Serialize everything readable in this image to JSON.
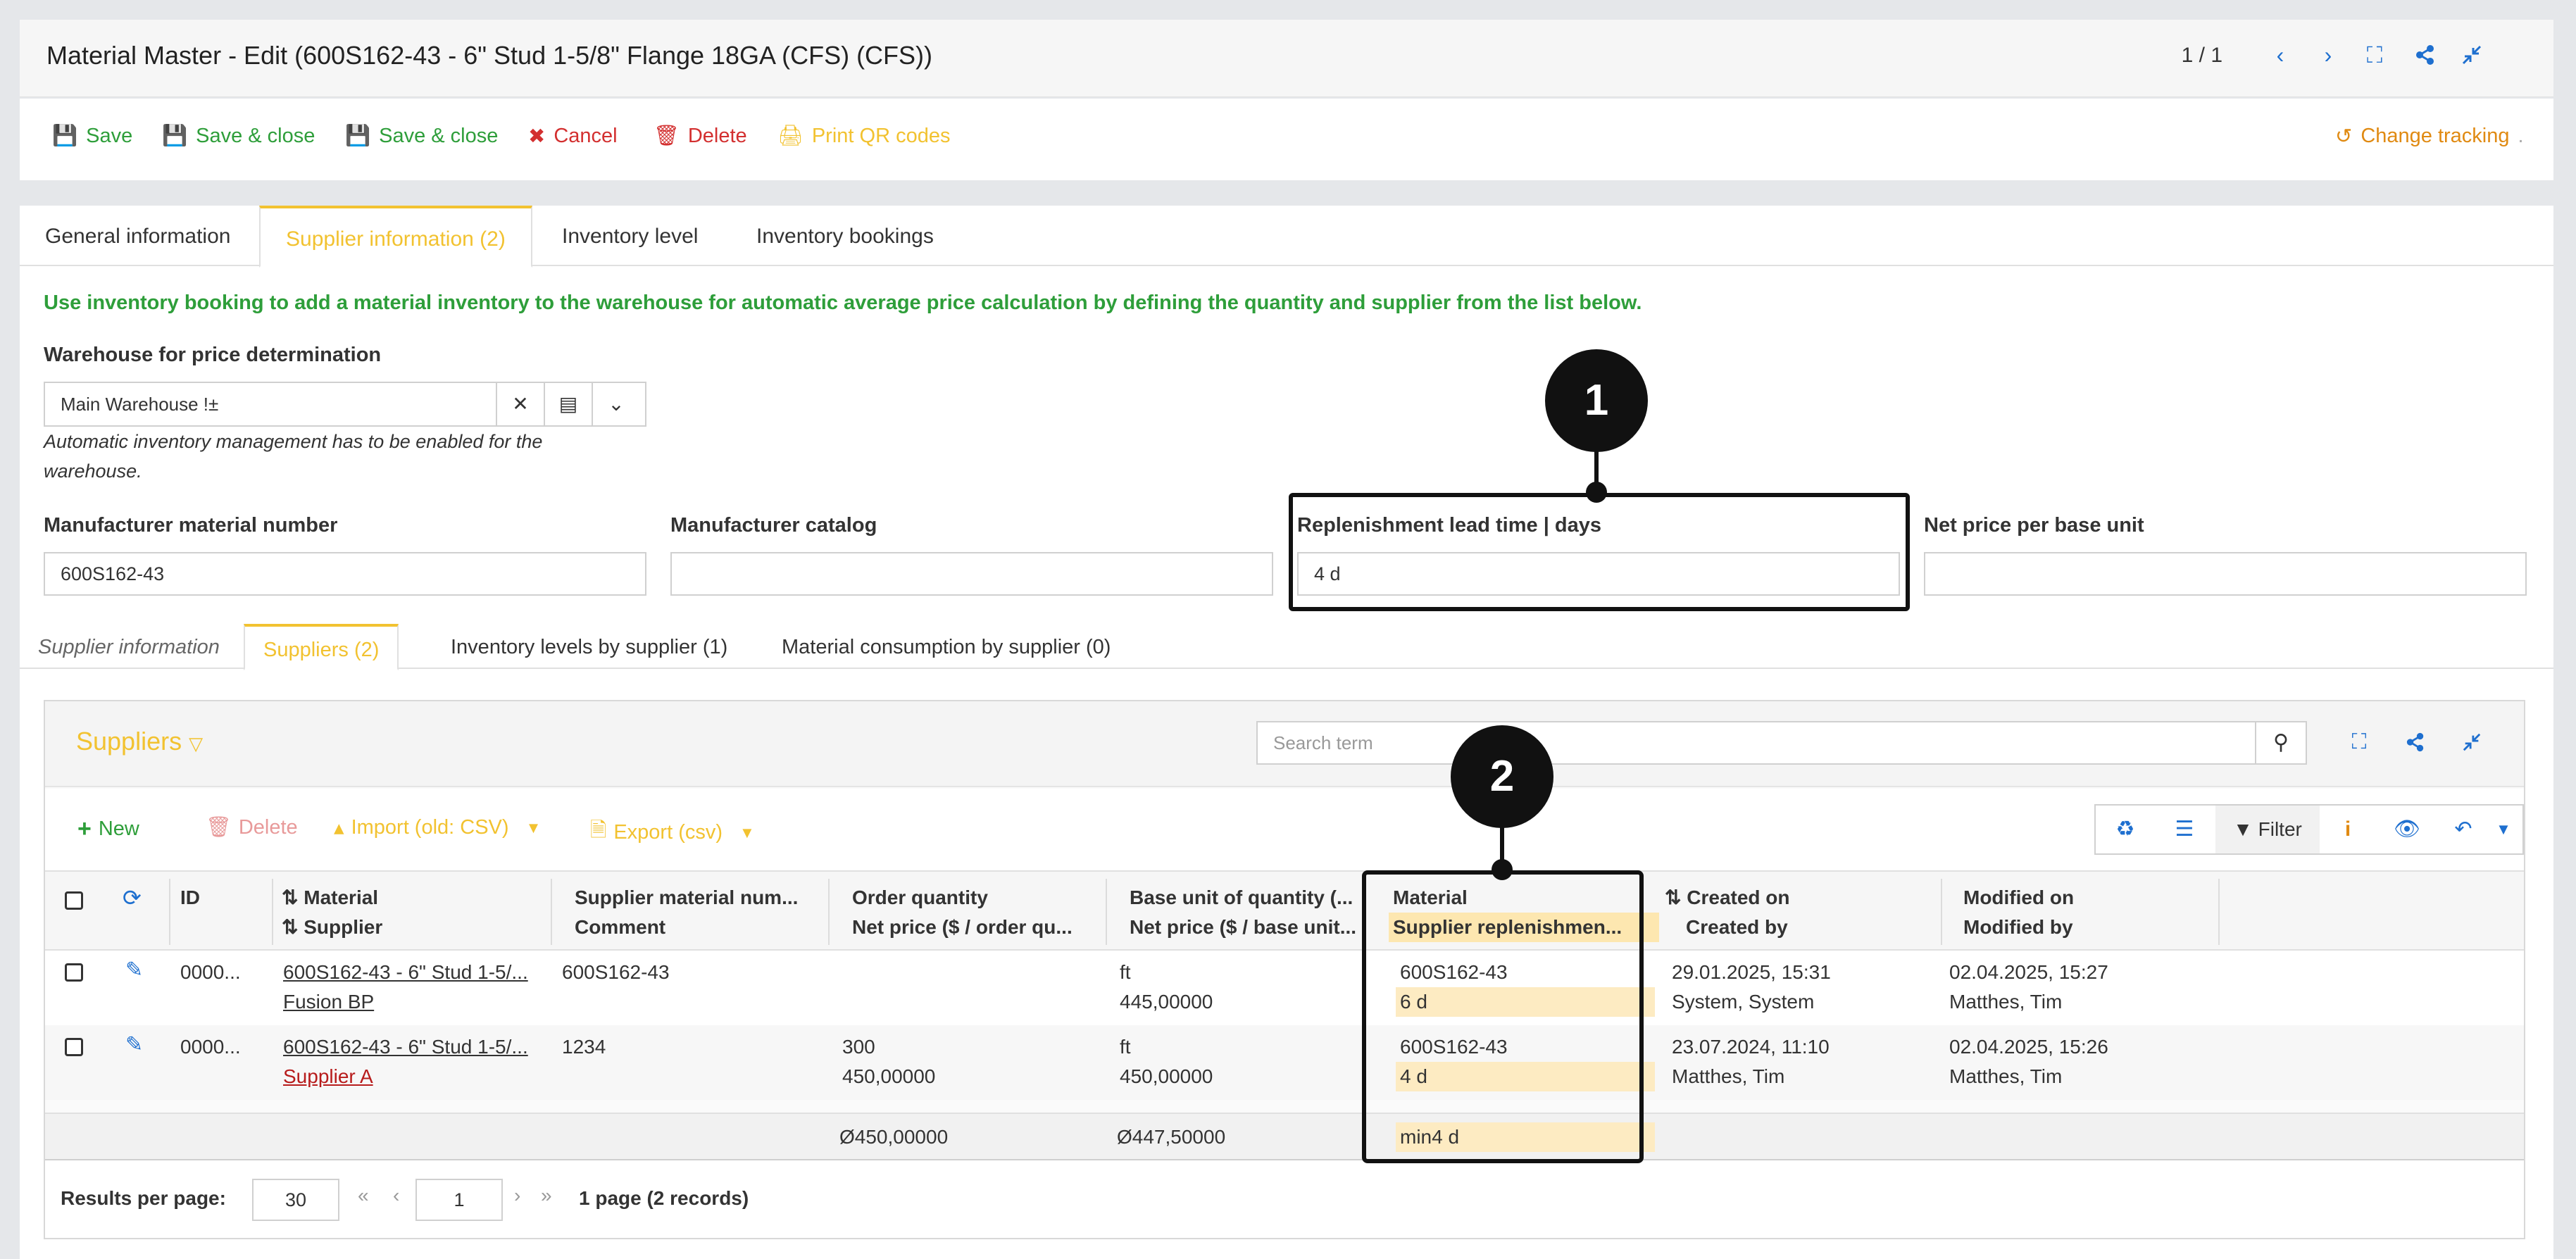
{
  "window": {
    "title": "Material Master - Edit (600S162-43 - 6\" Stud 1-5/8\" Flange 18GA (CFS) (CFS))",
    "pager": "1 / 1"
  },
  "toolbar": {
    "save": "Save",
    "save_close_1": "Save & close",
    "save_close_2": "Save & close",
    "cancel": "Cancel",
    "delete": "Delete",
    "print_qr": "Print QR codes",
    "change_tracking": "Change tracking"
  },
  "tabs": [
    "General information",
    "Supplier information (2)",
    "Inventory level",
    "Inventory bookings"
  ],
  "info_text": "Use inventory booking to add a material inventory to the warehouse for automatic average price calculation by defining the quantity and supplier from the list below.",
  "warehouse": {
    "label": "Warehouse for price determination",
    "value": "Main Warehouse !±",
    "hint_line1": "Automatic inventory management has to be enabled for the",
    "hint_line2": "warehouse."
  },
  "fields": {
    "mfr_number_label": "Manufacturer material number",
    "mfr_number_value": "600S162-43",
    "mfr_catalog_label": "Manufacturer catalog",
    "mfr_catalog_value": "",
    "lead_time_label": "Replenishment lead time | days",
    "lead_time_value": "4 d",
    "net_price_label": "Net price per base unit",
    "net_price_value": ""
  },
  "callouts": {
    "one": "1",
    "two": "2"
  },
  "subtabs": [
    "Supplier information",
    "Suppliers (2)",
    "Inventory levels by supplier (1)",
    "Material consumption by supplier (0)"
  ],
  "grid": {
    "title": "Suppliers",
    "search_placeholder": "Search term",
    "new": "New",
    "delete": "Delete",
    "import": "Import (old: CSV)",
    "export": "Export (csv)",
    "filter": "Filter",
    "columns": {
      "id": "ID",
      "material_1": "Material",
      "material_2": "Supplier",
      "supmat_1": "Supplier material num...",
      "supmat_2": "Comment",
      "order_1": "Order quantity",
      "order_2": "Net price ($ / order qu...",
      "base_1": "Base unit of quantity (...",
      "base_2": "Net price ($ / base unit...",
      "mat_1": "Material",
      "mat_2": "Supplier replenishmen...",
      "created_1": "Created on",
      "created_2": "Created by",
      "modified_1": "Modified on",
      "modified_2": "Modified by"
    },
    "rows": [
      {
        "id": "0000...",
        "material": "600S162-43 - 6\" Stud 1-5/...",
        "supplier": "Fusion BP",
        "supmat": "600S162-43",
        "comment": "",
        "order_qty": "",
        "order_price": "",
        "base_unit": "ft",
        "base_price": "445,00000",
        "mat": "600S162-43",
        "lead": "6 d",
        "created_on": "29.01.2025, 15:31",
        "created_by": "System, System",
        "modified_on": "02.04.2025, 15:27",
        "modified_by": "Matthes, Tim"
      },
      {
        "id": "0000...",
        "material": "600S162-43 - 6\" Stud 1-5/...",
        "supplier": "Supplier A",
        "supmat": "1234",
        "comment": "",
        "order_qty": "300",
        "order_price": "450,00000",
        "base_unit": "ft",
        "base_price": "450,00000",
        "mat": "600S162-43",
        "lead": "4 d",
        "created_on": "23.07.2024, 11:10",
        "created_by": "Matthes, Tim",
        "modified_on": "02.04.2025, 15:26",
        "modified_by": "Matthes, Tim"
      }
    ],
    "summary": {
      "order_price": "Ø450,00000",
      "base_price": "Ø447,50000",
      "lead": "min4 d"
    },
    "footer": {
      "results_label": "Results per page:",
      "results_value": "30",
      "page_value": "1",
      "page_info": "1 page (2 records)"
    }
  }
}
